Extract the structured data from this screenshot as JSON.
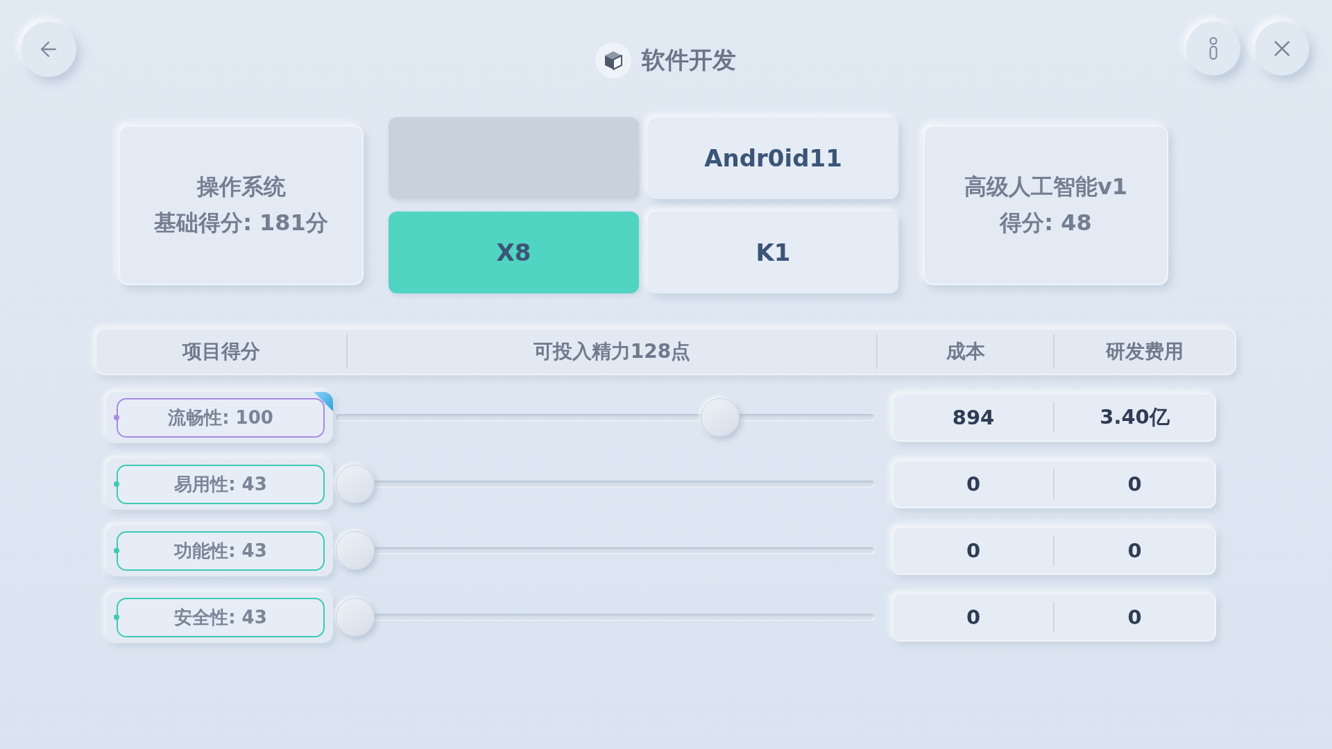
{
  "header": {
    "title": "软件开发"
  },
  "system_card": {
    "title": "操作系统",
    "score": "基础得分: 181分"
  },
  "options": [
    {
      "kind": "blank",
      "selected": false
    },
    {
      "kind": "option",
      "label": "Andr0id11",
      "selected": false
    },
    {
      "kind": "option",
      "label": "X8",
      "selected": true
    },
    {
      "kind": "option",
      "label": "K1",
      "selected": false
    }
  ],
  "ai_card": {
    "title": "高级人工智能v1",
    "score": "得分: 48"
  },
  "table": {
    "columns": [
      "项目得分",
      "可投入精力128点",
      "成本",
      "研发费用"
    ],
    "rows": [
      {
        "label": "流畅性: 100",
        "color": "#a88ae6",
        "flagged": true,
        "level": 0.73,
        "cost": "894",
        "fee": "3.40亿"
      },
      {
        "label": "易用性: 43",
        "color": "#3fc9b4",
        "flagged": false,
        "level": 0,
        "cost": "0",
        "fee": "0"
      },
      {
        "label": "功能性: 43",
        "color": "#3fc9b4",
        "flagged": false,
        "level": 0,
        "cost": "0",
        "fee": "0"
      },
      {
        "label": "安全性: 43",
        "color": "#3fc9b4",
        "flagged": false,
        "level": 0,
        "cost": "0",
        "fee": "0"
      }
    ]
  }
}
